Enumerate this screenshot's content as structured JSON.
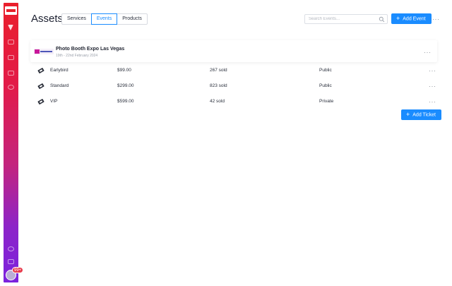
{
  "page": {
    "title": "Assets"
  },
  "tabs": [
    {
      "label": "Services",
      "active": false
    },
    {
      "label": "Events",
      "active": true
    },
    {
      "label": "Products",
      "active": false
    }
  ],
  "search": {
    "placeholder": "Search Events...",
    "value": ""
  },
  "toolbar": {
    "add_event_label": "Add Event",
    "more_label": "···"
  },
  "sidebar": {
    "icons": [
      "funnel-icon",
      "calendar-icon",
      "cart-icon",
      "image-icon",
      "settings-icon",
      "help-icon",
      "mail-icon"
    ],
    "notification_count": "99+"
  },
  "event": {
    "title": "Photo Booth Expo Las Vegas",
    "date": "19th - 22nd February 2024",
    "more_label": "···"
  },
  "tickets": [
    {
      "name": "Earlybird",
      "price": "$99.00",
      "sold": "267 sold",
      "visibility": "Public",
      "more_label": "···"
    },
    {
      "name": "Standard",
      "price": "$299.00",
      "sold": "823 sold",
      "visibility": "Public",
      "more_label": "···"
    },
    {
      "name": "VIP",
      "price": "$599.00",
      "sold": "42 sold",
      "visibility": "Private",
      "more_label": "···"
    }
  ],
  "add_ticket_label": "Add Ticket",
  "colors": {
    "accent": "#1a8cff",
    "sidebar_top": "#ea1f2b",
    "sidebar_bottom": "#7b22dd",
    "badge": "#e83a4b"
  }
}
